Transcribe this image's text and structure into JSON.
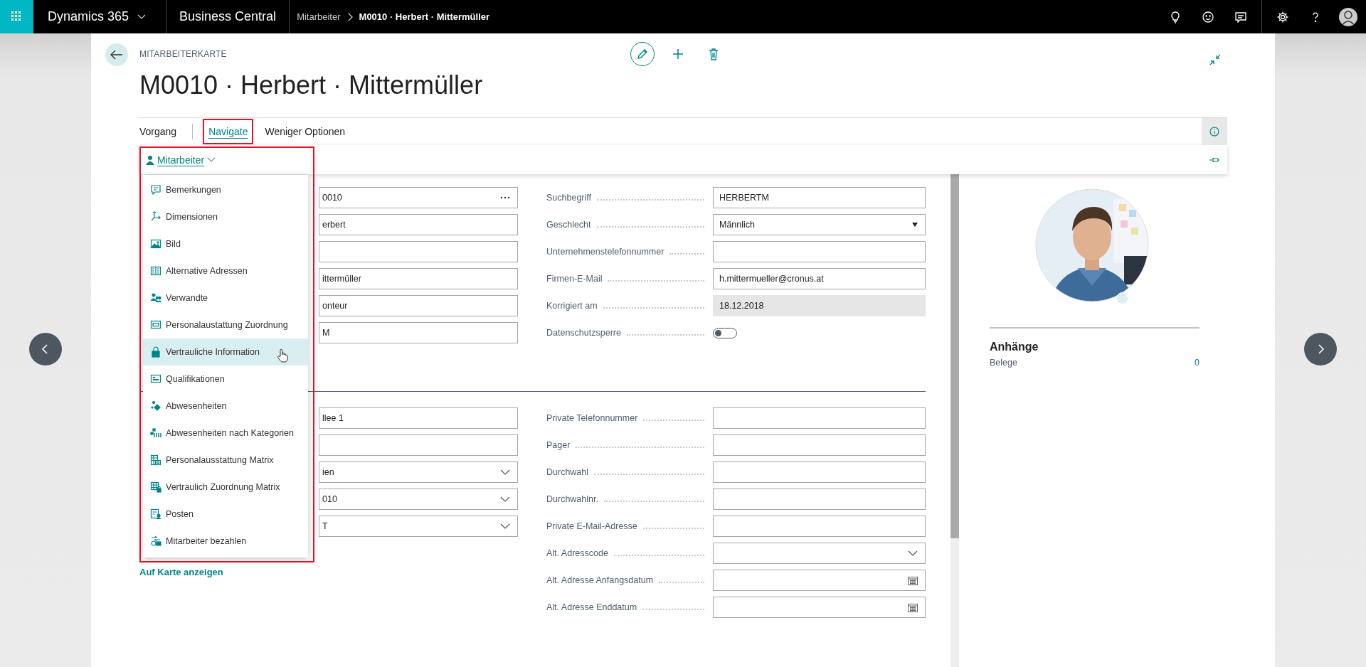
{
  "topbar": {
    "app_name": "Dynamics 365",
    "product": "Business Central",
    "breadcrumb": [
      {
        "label": "Mitarbeiter",
        "current": false
      },
      {
        "label": "M0010 · Herbert · Mittermüller",
        "current": true
      }
    ]
  },
  "page": {
    "caption": "MITARBEITERKARTE",
    "title": "M0010 · Herbert · Mittermüller"
  },
  "action_tabs": [
    {
      "label": "Vorgang",
      "selected": false,
      "highlighted": false
    },
    {
      "label": "Navigate",
      "selected": true,
      "highlighted": true
    },
    {
      "label": "Weniger Optionen",
      "selected": false,
      "highlighted": false
    }
  ],
  "submenu": {
    "label": "Mitarbeiter",
    "highlighted": true,
    "items": [
      {
        "label": "Bemerkungen",
        "selected": false
      },
      {
        "label": "Dimensionen",
        "selected": false
      },
      {
        "label": "Bild",
        "selected": false
      },
      {
        "label": "Alternative Adressen",
        "selected": false
      },
      {
        "label": "Verwandte",
        "selected": false
      },
      {
        "label": "Personalaustattung Zuordnung",
        "selected": false
      },
      {
        "label": "Vertrauliche Information",
        "selected": true
      },
      {
        "label": "Qualifikationen",
        "selected": false
      },
      {
        "label": "Abwesenheiten",
        "selected": false
      },
      {
        "label": "Abwesenheiten nach Kategorien",
        "selected": false
      },
      {
        "label": "Personalausstattung Matrix",
        "selected": false
      },
      {
        "label": "Vertraulich Zuordnung Matrix",
        "selected": false
      },
      {
        "label": "Posten",
        "selected": false
      },
      {
        "label": "Mitarbeiter bezahlen",
        "selected": false
      }
    ]
  },
  "general_left": [
    {
      "kind": "lookup",
      "value": "0010"
    },
    {
      "kind": "text",
      "value": "erbert"
    },
    {
      "kind": "text"
    },
    {
      "kind": "text",
      "value": "ittermüller"
    },
    {
      "kind": "text",
      "value": "onteur"
    },
    {
      "kind": "text",
      "value": "M"
    }
  ],
  "general_right": [
    {
      "kind": "text",
      "label": "Suchbegriff",
      "value": "HERBERTM"
    },
    {
      "kind": "select",
      "label": "Geschlecht",
      "value": "Männlich"
    },
    {
      "kind": "text",
      "label": "Unternehmenstelefonnummer"
    },
    {
      "kind": "text",
      "label": "Firmen-E-Mail",
      "value": "h.mittermueller@cronus.at"
    },
    {
      "kind": "readonly",
      "label": "Korrigiert am",
      "value": "18.12.2018"
    },
    {
      "kind": "toggle",
      "label": "Datenschutzsperre",
      "on": false
    }
  ],
  "address_left": [
    {
      "kind": "text",
      "value": "llee 1"
    },
    {
      "kind": "text"
    },
    {
      "kind": "dropdown",
      "value": "ien"
    },
    {
      "kind": "dropdown",
      "value": "010"
    },
    {
      "kind": "dropdown",
      "value": "T"
    }
  ],
  "address_link": "Auf Karte anzeigen",
  "address_right": [
    {
      "kind": "text",
      "label": "Private Telefonnummer"
    },
    {
      "kind": "text",
      "label": "Pager"
    },
    {
      "kind": "text",
      "label": "Durchwahl"
    },
    {
      "kind": "text",
      "label": "Durchwahlnr."
    },
    {
      "kind": "text",
      "label": "Private E-Mail-Adresse"
    },
    {
      "kind": "dropdown",
      "label": "Alt. Adresscode"
    },
    {
      "kind": "date",
      "label": "Alt. Adresse Anfangsdatum"
    },
    {
      "kind": "date",
      "label": "Alt. Adresse Enddatum"
    }
  ],
  "factbox": {
    "title": "Anhänge",
    "rows": [
      {
        "label": "Belege",
        "value": "0"
      }
    ]
  }
}
